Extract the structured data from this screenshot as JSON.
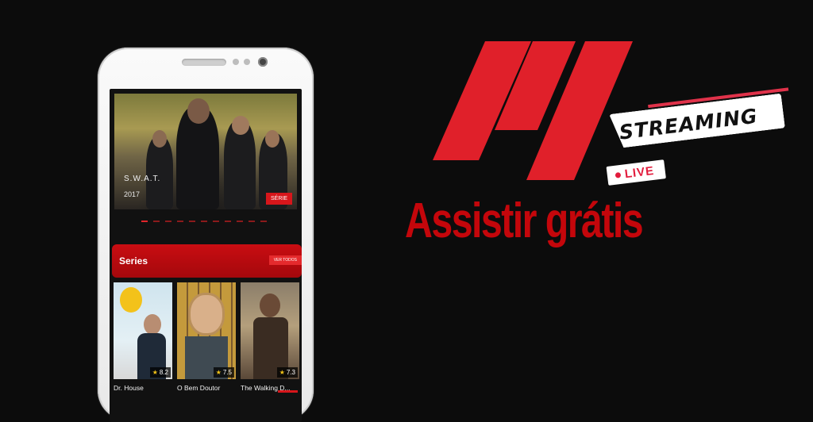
{
  "hero": {
    "title": "S.W.A.T.",
    "year": "2017",
    "badge": "SÉRIE",
    "slides": 11,
    "active_slide": 0
  },
  "section": {
    "title": "Series",
    "see_all": "VER TODOS"
  },
  "cards": [
    {
      "title": "Dr. House",
      "rating": "8.2"
    },
    {
      "title": "O Bem Doutor",
      "rating": "7.5"
    },
    {
      "title": "The Walking D...",
      "rating": "7.3"
    }
  ],
  "brand": {
    "streaming": "STREAMING",
    "live": "LIVE",
    "tagline": "Assistir grátis",
    "accent_color": "#e0202a",
    "tagline_color": "#c4060b"
  },
  "icons": {
    "rating": "star-icon",
    "live": "dot-icon"
  }
}
